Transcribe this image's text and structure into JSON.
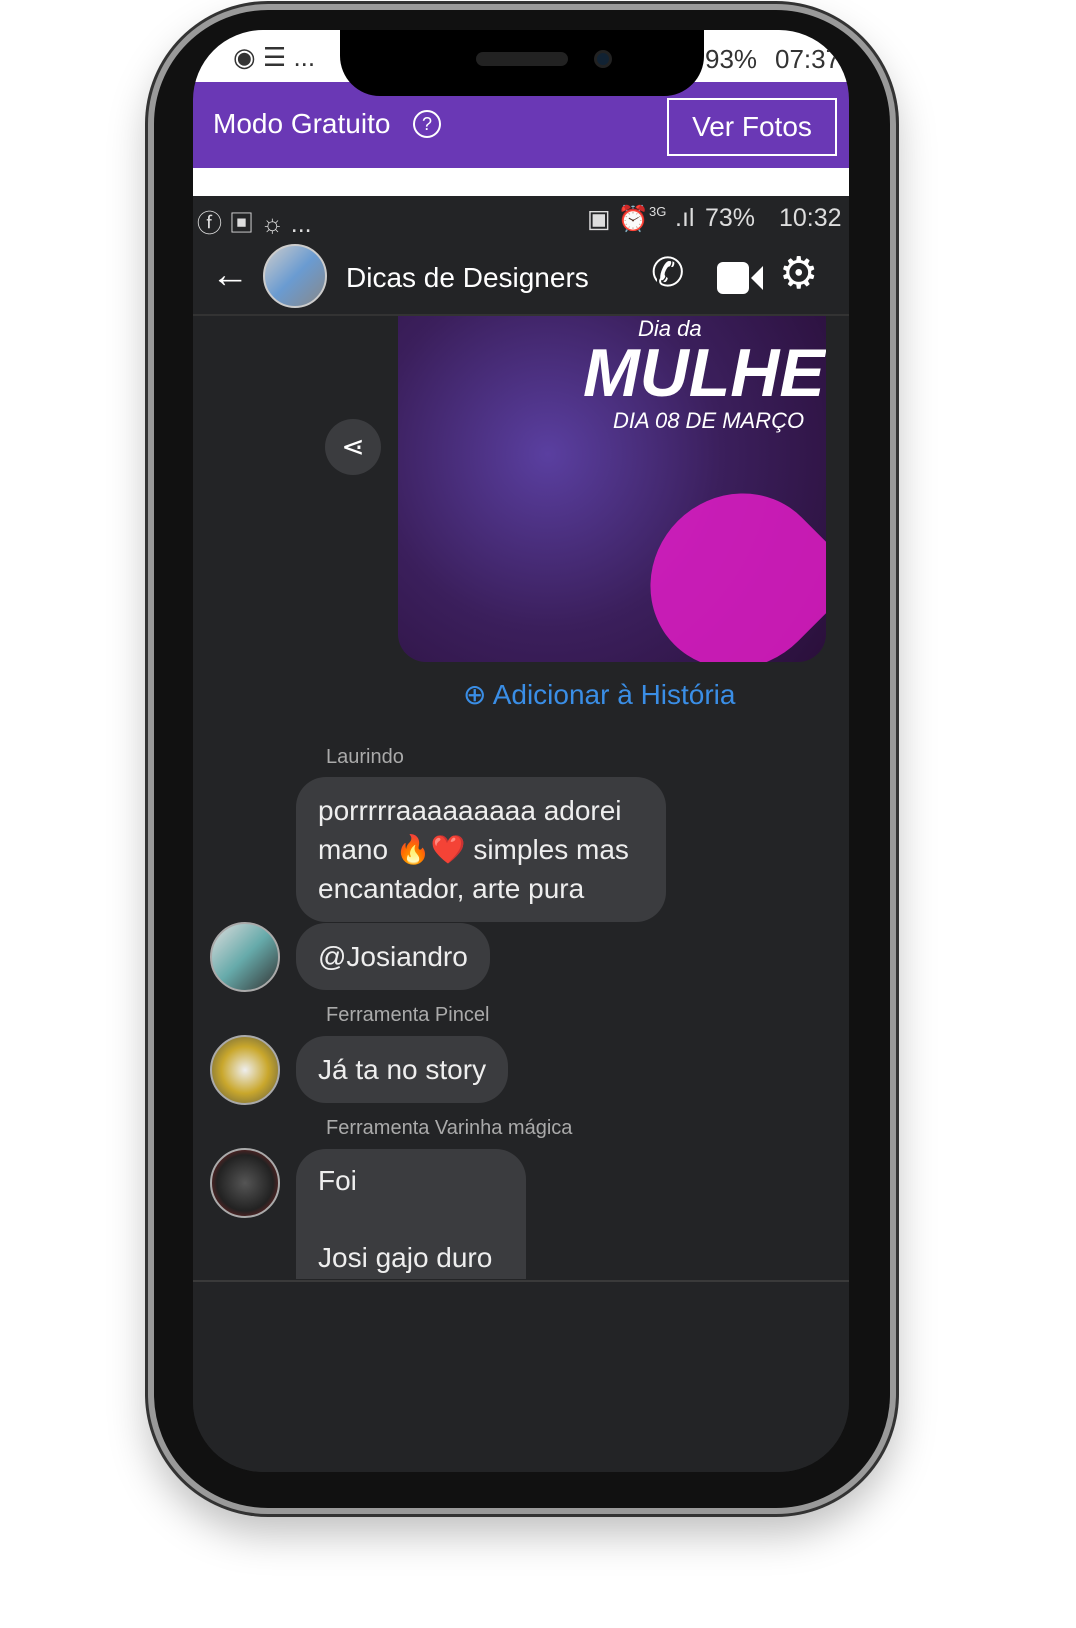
{
  "outer_status": {
    "battery": "93%",
    "time": "07:37",
    "more": "..."
  },
  "banner": {
    "title": "Modo Gratuito",
    "help_icon": "question-circle-icon",
    "button": "Ver Fotos",
    "color": "#6a38b5"
  },
  "inner_status": {
    "more": "...",
    "network": "3G",
    "battery": "73%",
    "time": "10:32"
  },
  "header": {
    "title": "Dicas de Designers"
  },
  "image": {
    "title": "Dia da",
    "headline": "MULHER",
    "subtitle": "DIA 08 DE MARÇO"
  },
  "add_story": "Adicionar à História",
  "accent": "#3a8ee6",
  "messages": [
    {
      "sender": "Laurindo",
      "text": "porrrrraaaaaaaaa adorei mano 🔥❤️ simples mas encantador, arte pura"
    },
    {
      "text": "@Josiandro"
    },
    {
      "sender": "Ferramenta Pincel",
      "text": "Já ta no story"
    },
    {
      "sender": "Ferramenta Varinha mágica",
      "line1": "Foi",
      "line2": "Josi gajo duro"
    }
  ]
}
